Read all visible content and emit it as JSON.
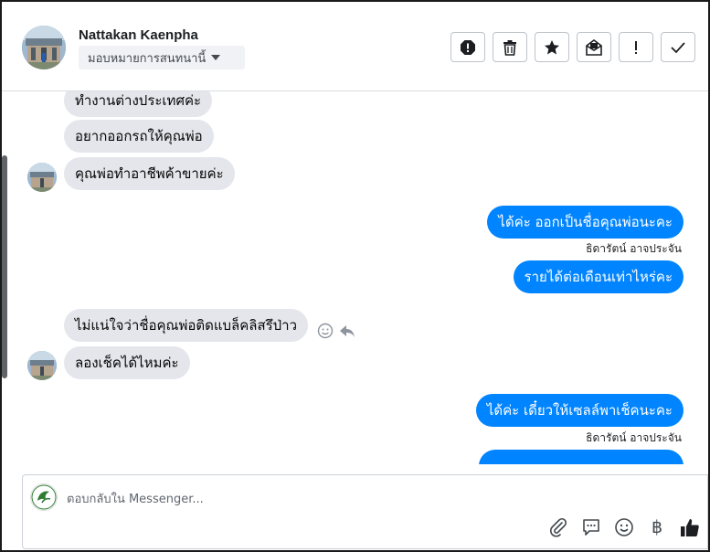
{
  "header": {
    "name": "Nattakan Kaenpha",
    "assign_label": "มอบหมายการสนทนานี้",
    "actions": [
      {
        "name": "mark-spam-button",
        "icon": "alert-octagon-icon"
      },
      {
        "name": "delete-button",
        "icon": "trash-icon"
      },
      {
        "name": "star-button",
        "icon": "star-icon"
      },
      {
        "name": "mark-unread-button",
        "icon": "envelope-icon"
      },
      {
        "name": "follow-up-button",
        "icon": "exclamation-icon"
      },
      {
        "name": "mark-done-button",
        "icon": "check-icon"
      }
    ]
  },
  "messages": {
    "in1": "ทำงานต่างประเทศค่ะ",
    "in2": "อยากออกรถให้คุณพ่อ",
    "in3": "คุณพ่อทำอาชีพค้าขายค่ะ",
    "out1": "ได้ค่ะ ออกเป็นชื่อคุณพ่อนะคะ",
    "out1_sender": "ธิดารัตน์ อาจประจัน",
    "out2": "รายได้ต่อเดือนเท่าไหร่คะ",
    "in4": "ไม่แน่ใจว่าชื่อคุณพ่อติดแบล็คลิสรึป่าว",
    "in5": "ลองเช็คได้ไหมค่ะ",
    "out3": "ได้ค่ะ เดี๋ยวให้เซลล์พาเช็คนะคะ",
    "out3_sender": "ธิดารัตน์ อาจประจัน"
  },
  "composer": {
    "placeholder": "ตอบกลับใน Messenger...",
    "currency_symbol": "฿"
  },
  "colors": {
    "outgoing": "#0084ff",
    "incoming": "#e4e6eb"
  }
}
